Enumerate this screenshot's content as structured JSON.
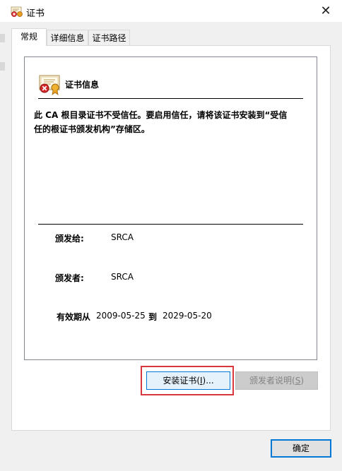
{
  "window": {
    "title": "证书"
  },
  "tabs": [
    {
      "label": "常规",
      "active": true
    },
    {
      "label": "详细信息",
      "active": false
    },
    {
      "label": "证书路径",
      "active": false
    }
  ],
  "info": {
    "heading": "证书信息",
    "warning_line1": "此 CA 根目录证书不受信任。要启用信任，请将该证书安装到“受信",
    "warning_line2": "任的根证书颁发机构”存储区。"
  },
  "fields": {
    "issued_to_label": "颁发给:",
    "issued_to_value": "SRCA",
    "issued_by_label": "颁发者:",
    "issued_by_value": "SRCA",
    "validity_label": "有效期从",
    "valid_from": "2009-05-25",
    "to_label": "到",
    "valid_to": "2029-05-20"
  },
  "buttons": {
    "install_label": "安装证书(",
    "install_key": "I",
    "install_suffix": ")...",
    "issuer_statement_label": "颁发者说明(",
    "issuer_statement_key": "S",
    "issuer_statement_suffix": ")",
    "ok_label": "确定"
  },
  "colors": {
    "accent": "#0078d7",
    "highlight_box": "#d9363e",
    "disabled_button": "#cccccc"
  },
  "icons": {
    "title": "certificate-icon",
    "cert_info": "untrusted-certificate-icon",
    "close": "close-icon"
  }
}
